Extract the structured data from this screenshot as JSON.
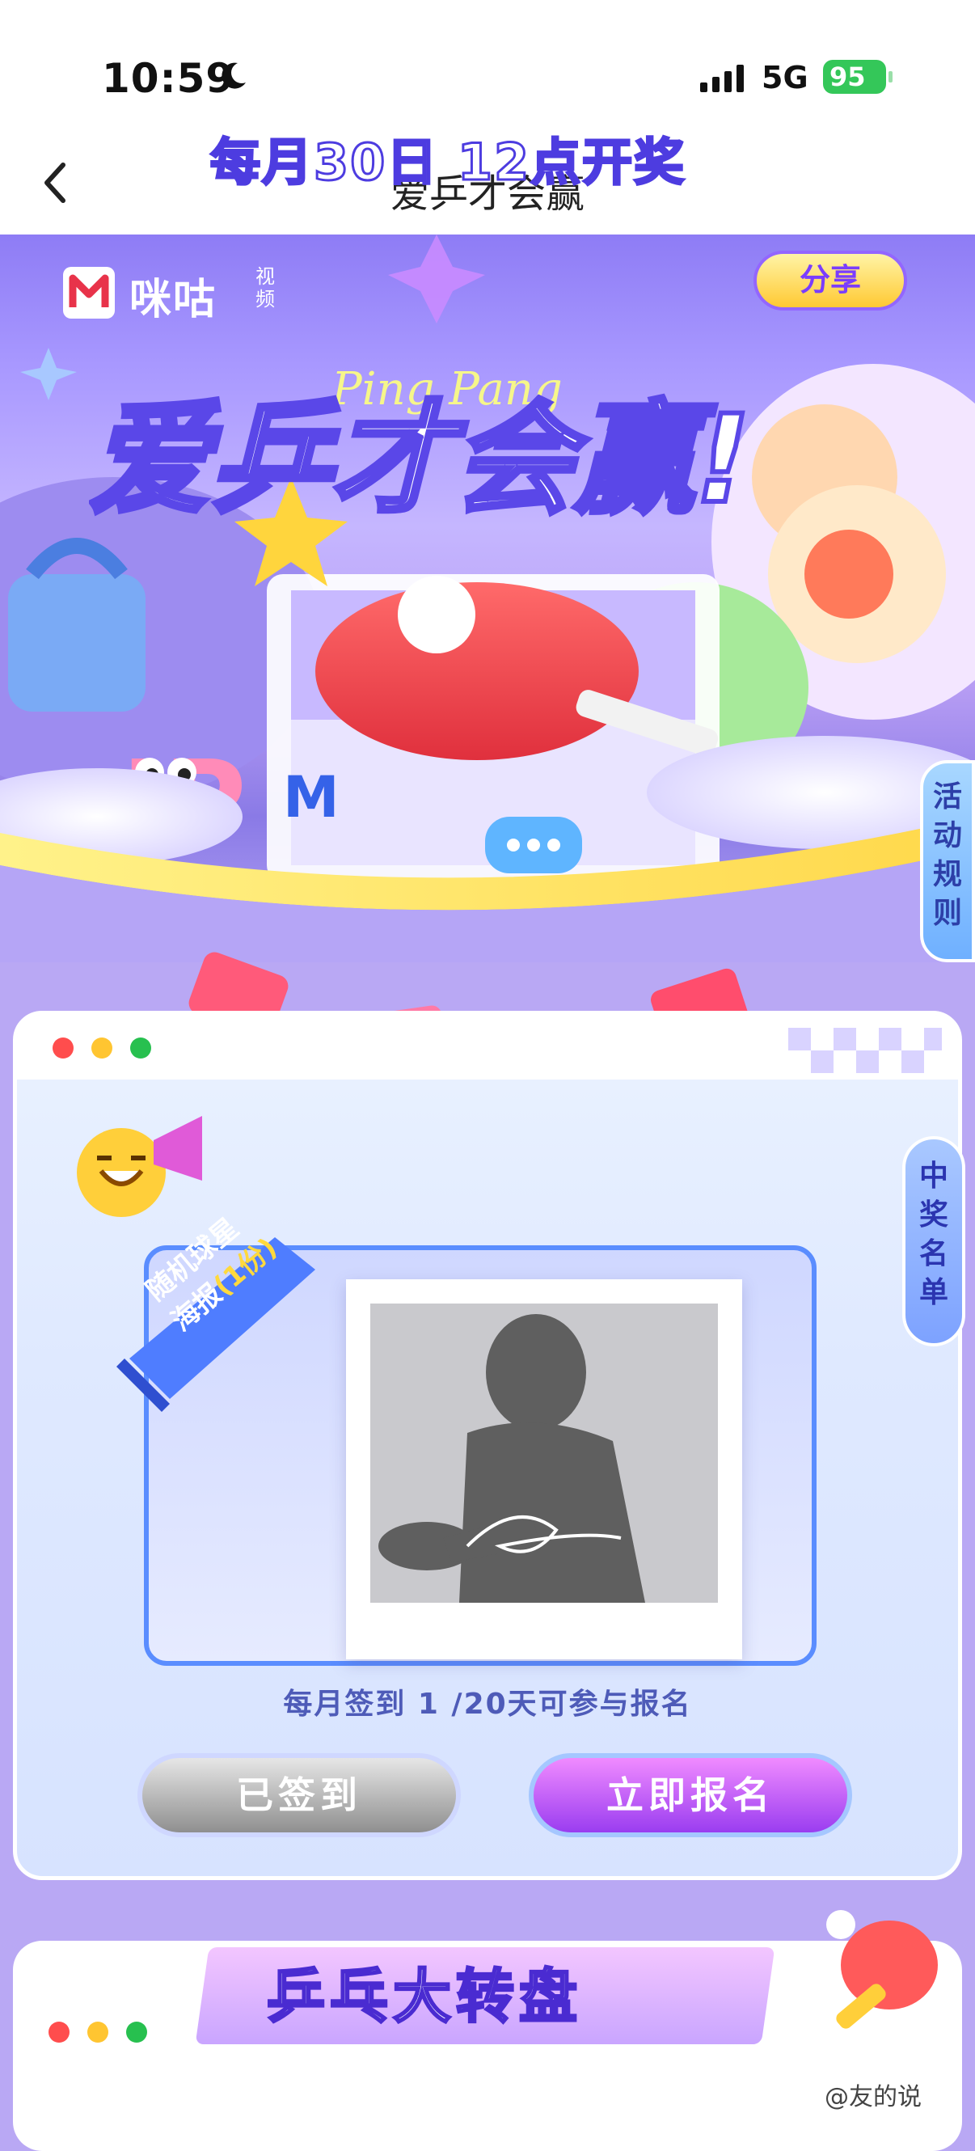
{
  "status_bar": {
    "time": "10:59",
    "network": "5G",
    "battery": "95"
  },
  "nav": {
    "title": "爱乒才会赢"
  },
  "hero": {
    "logo_text": "咪咕",
    "logo_sub": "视频",
    "share_label": "分享",
    "title_art": "爱乒才会赢!",
    "title_script": "Ping Pang",
    "rules_tab": "活动规则"
  },
  "lottery": {
    "banner": "每月30日  12点开奖",
    "winners_tab": "中奖名单",
    "prize_ribbon_line1": "随机球星",
    "prize_ribbon_line2": "海报",
    "prize_ribbon_count": "(1份)",
    "progress_text": "每月签到  1   /20天可参与报名",
    "signed_button": "已签到",
    "join_button": "立即报名"
  },
  "wheel": {
    "title": "乒乓大转盘"
  },
  "watermark": "@友的说",
  "colors": {
    "accent_purple": "#7a3dff",
    "frame_blue": "#5a8dff",
    "status_green": "#34c759"
  }
}
